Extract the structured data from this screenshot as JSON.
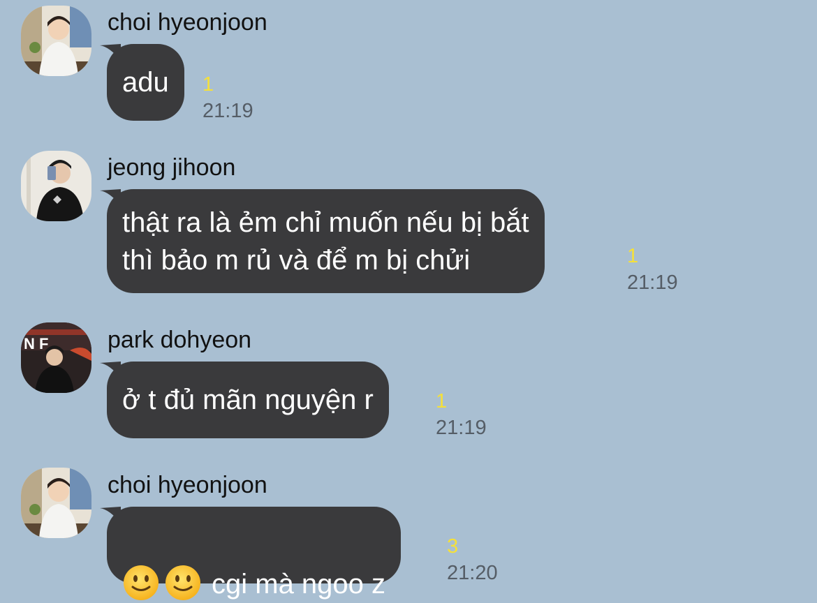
{
  "messages": [
    {
      "sender": "choi hyeonjoon",
      "avatar_icon": "profile-photo-choi-hyeonjoon",
      "text": "adu",
      "unread": "1",
      "time": "21:19"
    },
    {
      "sender": "jeong jihoon",
      "avatar_icon": "profile-photo-jeong-jihoon",
      "text": "thật ra là ẻm chỉ muốn nếu bị bắt\nthì bảo m rủ và để m bị chửi",
      "unread": "1",
      "time": "21:19"
    },
    {
      "sender": "park dohyeon",
      "avatar_icon": "profile-photo-park-dohyeon",
      "text": "ở t đủ mãn nguyện r",
      "unread": "1",
      "time": "21:19"
    },
    {
      "sender": "choi hyeonjoon",
      "avatar_icon": "profile-photo-choi-hyeonjoon",
      "emojis": [
        "slightly-smiling-face-emoji",
        "slightly-smiling-face-emoji"
      ],
      "text": "cgi mà ngoo z",
      "unread": "3",
      "time": "21:20"
    }
  ],
  "colors": {
    "background": "#a9bfd2",
    "bubble": "#3a3a3c",
    "unread": "#f5e03a",
    "time": "#555d66"
  }
}
